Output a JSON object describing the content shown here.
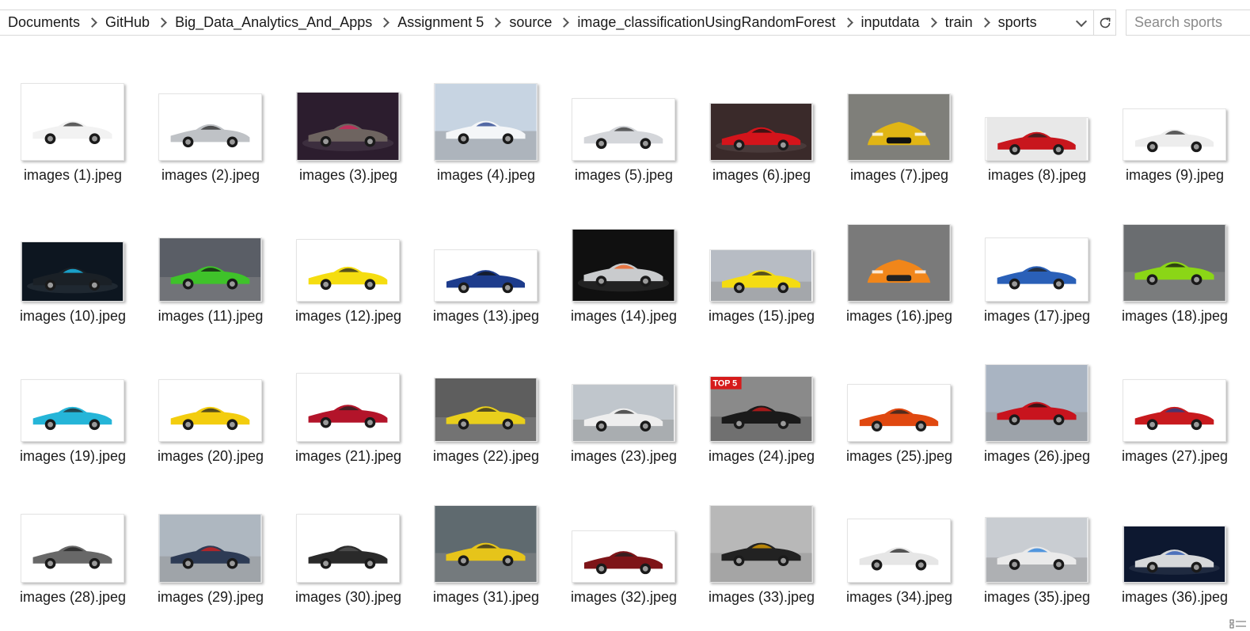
{
  "breadcrumb": [
    "Documents",
    "GitHub",
    "Big_Data_Analytics_And_Apps",
    "Assignment 5",
    "source",
    "image_classificationUsingRandomForest",
    "inputdata",
    "train",
    "sports"
  ],
  "search": {
    "placeholder": "Search sports"
  },
  "icons": {
    "separator": "chevron-right-icon",
    "history": "chevron-down-icon",
    "refresh": "refresh-icon",
    "view_toggle": "details-view-icon"
  },
  "files": [
    {
      "name": "images (1).jpeg",
      "thumb": {
        "h": 98,
        "bg": "#ffffff",
        "body": "#f2f2f2",
        "accent": "#2b2b2b",
        "scene": "studio"
      }
    },
    {
      "name": "images (2).jpeg",
      "thumb": {
        "h": 85,
        "bg": "#ffffff",
        "body": "#bfc2c6",
        "accent": "#2a2a2a",
        "scene": "studio"
      }
    },
    {
      "name": "images (3).jpeg",
      "thumb": {
        "h": 87,
        "bg": "#2c1d2e",
        "body": "#6e6460",
        "accent": "#d8205a",
        "scene": "dark"
      }
    },
    {
      "name": "images (4).jpeg",
      "thumb": {
        "h": 98,
        "bg": "#c7d4e2",
        "body": "#f4f6f8",
        "accent": "#1e3a8a",
        "scene": "outdoor"
      }
    },
    {
      "name": "images (5).jpeg",
      "thumb": {
        "h": 79,
        "bg": "#ffffff",
        "body": "#d4d6da",
        "accent": "#333333",
        "scene": "studio"
      }
    },
    {
      "name": "images (6).jpeg",
      "thumb": {
        "h": 73,
        "bg": "#3a2a2a",
        "body": "#d4141b",
        "accent": "#111111",
        "scene": "dark"
      }
    },
    {
      "name": "images (7).jpeg",
      "thumb": {
        "h": 85,
        "bg": "#7f7f7a",
        "body": "#e1b514",
        "accent": "#111111",
        "scene": "front"
      }
    },
    {
      "name": "images (8).jpeg",
      "thumb": {
        "h": 55,
        "bg": "#e8e8e8",
        "body": "#c8161d",
        "accent": "#222222",
        "scene": "studio"
      }
    },
    {
      "name": "images (9).jpeg",
      "thumb": {
        "h": 66,
        "bg": "#ffffff",
        "body": "#ededed",
        "accent": "#2a2a2a",
        "scene": "studio"
      }
    },
    {
      "name": "images (10).jpeg",
      "thumb": {
        "h": 76,
        "bg": "#0d1620",
        "body": "#1a2026",
        "accent": "#19c9ff",
        "scene": "dark"
      }
    },
    {
      "name": "images (11).jpeg",
      "thumb": {
        "h": 81,
        "bg": "#5a5e66",
        "body": "#3fc22a",
        "accent": "#111111",
        "scene": "outdoor"
      }
    },
    {
      "name": "images (12).jpeg",
      "thumb": {
        "h": 79,
        "bg": "#ffffff",
        "body": "#f5dd10",
        "accent": "#222222",
        "scene": "studio"
      }
    },
    {
      "name": "images (13).jpeg",
      "thumb": {
        "h": 66,
        "bg": "#ffffff",
        "body": "#1d3c8c",
        "accent": "#111111",
        "scene": "studio"
      }
    },
    {
      "name": "images (14).jpeg",
      "thumb": {
        "h": 92,
        "bg": "#101010",
        "body": "#c9cbcd",
        "accent": "#f05a14",
        "scene": "dark"
      }
    },
    {
      "name": "images (15).jpeg",
      "thumb": {
        "h": 66,
        "bg": "#b7bcc4",
        "body": "#f4dc12",
        "accent": "#222222",
        "scene": "outdoor"
      }
    },
    {
      "name": "images (16).jpeg",
      "thumb": {
        "h": 98,
        "bg": "#7a7a7a",
        "body": "#f1861a",
        "accent": "#222222",
        "scene": "front"
      }
    },
    {
      "name": "images (17).jpeg",
      "thumb": {
        "h": 81,
        "bg": "#ffffff",
        "body": "#2a60b8",
        "accent": "#222222",
        "scene": "studio"
      }
    },
    {
      "name": "images (18).jpeg",
      "thumb": {
        "h": 98,
        "bg": "#6a6d70",
        "body": "#8bd616",
        "accent": "#111111",
        "scene": "outdoor"
      }
    },
    {
      "name": "images (19).jpeg",
      "thumb": {
        "h": 79,
        "bg": "#ffffff",
        "body": "#25b5d8",
        "accent": "#222222",
        "scene": "studio"
      }
    },
    {
      "name": "images (20).jpeg",
      "thumb": {
        "h": 79,
        "bg": "#ffffff",
        "body": "#f3cd0e",
        "accent": "#222222",
        "scene": "studio"
      }
    },
    {
      "name": "images (21).jpeg",
      "thumb": {
        "h": 87,
        "bg": "#ffffff",
        "body": "#b3142a",
        "accent": "#222222",
        "scene": "studio"
      }
    },
    {
      "name": "images (22).jpeg",
      "thumb": {
        "h": 81,
        "bg": "#5e5e5e",
        "body": "#e9cf1c",
        "accent": "#222222",
        "scene": "outdoor"
      }
    },
    {
      "name": "images (23).jpeg",
      "thumb": {
        "h": 73,
        "bg": "#c0c6cc",
        "body": "#eeeeee",
        "accent": "#222222",
        "scene": "outdoor"
      }
    },
    {
      "name": "images (24).jpeg",
      "thumb": {
        "h": 83,
        "bg": "#8a8a8a",
        "body": "#1a1a1a",
        "accent": "#d61b1b",
        "scene": "badge",
        "badge": "TOP 5"
      }
    },
    {
      "name": "images (25).jpeg",
      "thumb": {
        "h": 73,
        "bg": "#ffffff",
        "body": "#e04810",
        "accent": "#222222",
        "scene": "studio"
      }
    },
    {
      "name": "images (26).jpeg",
      "thumb": {
        "h": 98,
        "bg": "#a9b4c2",
        "body": "#c8141e",
        "accent": "#111111",
        "scene": "outdoor"
      }
    },
    {
      "name": "images (27).jpeg",
      "thumb": {
        "h": 79,
        "bg": "#ffffff",
        "body": "#c81a1e",
        "accent": "#1f3f8a",
        "scene": "studio"
      }
    },
    {
      "name": "images (28).jpeg",
      "thumb": {
        "h": 87,
        "bg": "#ffffff",
        "body": "#686868",
        "accent": "#222222",
        "scene": "studio"
      }
    },
    {
      "name": "images (29).jpeg",
      "thumb": {
        "h": 87,
        "bg": "#aeb7c0",
        "body": "#2d3b55",
        "accent": "#d8201e",
        "scene": "outdoor"
      }
    },
    {
      "name": "images (30).jpeg",
      "thumb": {
        "h": 87,
        "bg": "#ffffff",
        "body": "#2a2a2a",
        "accent": "#555555",
        "scene": "studio"
      }
    },
    {
      "name": "images (31).jpeg",
      "thumb": {
        "h": 98,
        "bg": "#5f6a6f",
        "body": "#e6c41a",
        "accent": "#222222",
        "scene": "outdoor"
      }
    },
    {
      "name": "images (32).jpeg",
      "thumb": {
        "h": 66,
        "bg": "#ffffff",
        "body": "#7e1418",
        "accent": "#222222",
        "scene": "studio"
      }
    },
    {
      "name": "images (33).jpeg",
      "thumb": {
        "h": 98,
        "bg": "#b8b8b8",
        "body": "#222222",
        "accent": "#e9a500",
        "scene": "outdoor"
      }
    },
    {
      "name": "images (34).jpeg",
      "thumb": {
        "h": 81,
        "bg": "#ffffff",
        "body": "#e6e6e6",
        "accent": "#222222",
        "scene": "studio"
      }
    },
    {
      "name": "images (35).jpeg",
      "thumb": {
        "h": 83,
        "bg": "#c9cdd2",
        "body": "#eaeaea",
        "accent": "#1f7ad8",
        "scene": "outdoor"
      }
    },
    {
      "name": "images (36).jpeg",
      "thumb": {
        "h": 72,
        "bg": "#0d1830",
        "body": "#d6d8da",
        "accent": "#1f4fb0",
        "scene": "dark"
      }
    }
  ]
}
